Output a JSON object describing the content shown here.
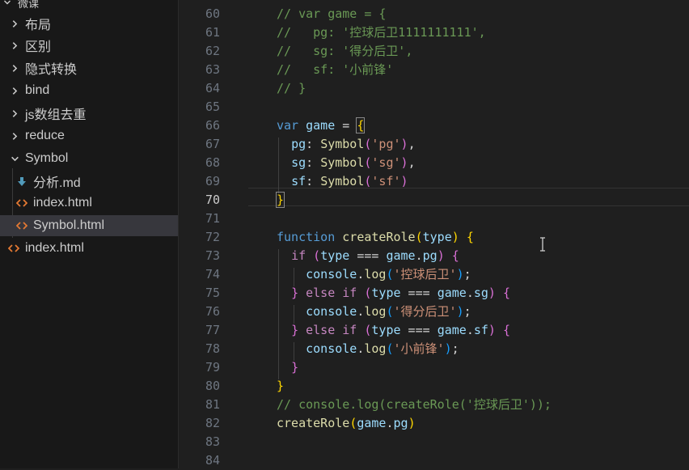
{
  "sidebar": {
    "header": "微课",
    "items": [
      {
        "label": "布局",
        "kind": "folder",
        "expanded": false
      },
      {
        "label": "区别",
        "kind": "folder",
        "expanded": false
      },
      {
        "label": "隐式转换",
        "kind": "folder",
        "expanded": false
      },
      {
        "label": "bind",
        "kind": "folder",
        "expanded": false
      },
      {
        "label": "js数组去重",
        "kind": "folder",
        "expanded": false
      },
      {
        "label": "reduce",
        "kind": "folder",
        "expanded": false
      },
      {
        "label": "Symbol",
        "kind": "folder",
        "expanded": true
      },
      {
        "label": "分析.md",
        "kind": "markdown-file"
      },
      {
        "label": "index.html",
        "kind": "html-file"
      },
      {
        "label": "Symbol.html",
        "kind": "html-file",
        "selected": true
      },
      {
        "label": "index.html",
        "kind": "html-file"
      }
    ]
  },
  "editor": {
    "active_line": 70,
    "lines": [
      {
        "n": 60,
        "tokens": [
          [
            "cmt",
            "// var game = {"
          ]
        ]
      },
      {
        "n": 61,
        "tokens": [
          [
            "cmt",
            "//   pg: '控球后卫1111111111',"
          ]
        ]
      },
      {
        "n": 62,
        "tokens": [
          [
            "cmt",
            "//   sg: '得分后卫',"
          ]
        ]
      },
      {
        "n": 63,
        "tokens": [
          [
            "cmt",
            "//   sf: '小前锋'"
          ]
        ]
      },
      {
        "n": 64,
        "tokens": [
          [
            "cmt",
            "// }"
          ]
        ]
      },
      {
        "n": 65,
        "tokens": []
      },
      {
        "n": 66,
        "tokens": [
          [
            "kw",
            "var"
          ],
          [
            "",
            " "
          ],
          [
            "var",
            "game"
          ],
          [
            "",
            " = "
          ],
          [
            "p1 bm",
            "{"
          ]
        ]
      },
      {
        "n": 67,
        "tokens": [
          [
            "",
            "  "
          ],
          [
            "var",
            "pg"
          ],
          [
            "",
            ": "
          ],
          [
            "fn",
            "Symbol"
          ],
          [
            "p2",
            "("
          ],
          [
            "str",
            "'pg'"
          ],
          [
            "p2",
            ")"
          ],
          [
            "",
            ","
          ]
        ]
      },
      {
        "n": 68,
        "tokens": [
          [
            "",
            "  "
          ],
          [
            "var",
            "sg"
          ],
          [
            "",
            ": "
          ],
          [
            "fn",
            "Symbol"
          ],
          [
            "p2",
            "("
          ],
          [
            "str",
            "'sg'"
          ],
          [
            "p2",
            ")"
          ],
          [
            "",
            ","
          ]
        ]
      },
      {
        "n": 69,
        "tokens": [
          [
            "",
            "  "
          ],
          [
            "var",
            "sf"
          ],
          [
            "",
            ": "
          ],
          [
            "fn",
            "Symbol"
          ],
          [
            "p2",
            "("
          ],
          [
            "str",
            "'sf'"
          ],
          [
            "p2",
            ")"
          ]
        ]
      },
      {
        "n": 70,
        "tokens": [
          [
            "p1 bm",
            "}"
          ]
        ]
      },
      {
        "n": 71,
        "tokens": []
      },
      {
        "n": 72,
        "tokens": [
          [
            "kw",
            "function"
          ],
          [
            "",
            " "
          ],
          [
            "fn",
            "createRole"
          ],
          [
            "p1",
            "("
          ],
          [
            "var",
            "type"
          ],
          [
            "p1",
            ")"
          ],
          [
            "",
            " "
          ],
          [
            "p1",
            "{"
          ]
        ]
      },
      {
        "n": 73,
        "tokens": [
          [
            "",
            "  "
          ],
          [
            "kw2",
            "if"
          ],
          [
            "",
            " "
          ],
          [
            "p2",
            "("
          ],
          [
            "var",
            "type"
          ],
          [
            "",
            " === "
          ],
          [
            "var",
            "game"
          ],
          [
            "",
            "."
          ],
          [
            "var",
            "pg"
          ],
          [
            "p2",
            ")"
          ],
          [
            "",
            " "
          ],
          [
            "p2",
            "{"
          ]
        ]
      },
      {
        "n": 74,
        "tokens": [
          [
            "",
            "    "
          ],
          [
            "var",
            "console"
          ],
          [
            "",
            "."
          ],
          [
            "fn",
            "log"
          ],
          [
            "p3",
            "("
          ],
          [
            "str",
            "'控球后卫'"
          ],
          [
            "p3",
            ")"
          ],
          [
            "",
            ";"
          ]
        ]
      },
      {
        "n": 75,
        "tokens": [
          [
            "",
            "  "
          ],
          [
            "p2",
            "}"
          ],
          [
            "",
            " "
          ],
          [
            "kw2",
            "else if"
          ],
          [
            "",
            " "
          ],
          [
            "p2",
            "("
          ],
          [
            "var",
            "type"
          ],
          [
            "",
            " === "
          ],
          [
            "var",
            "game"
          ],
          [
            "",
            "."
          ],
          [
            "var",
            "sg"
          ],
          [
            "p2",
            ")"
          ],
          [
            "",
            " "
          ],
          [
            "p2",
            "{"
          ]
        ]
      },
      {
        "n": 76,
        "tokens": [
          [
            "",
            "    "
          ],
          [
            "var",
            "console"
          ],
          [
            "",
            "."
          ],
          [
            "fn",
            "log"
          ],
          [
            "p3",
            "("
          ],
          [
            "str",
            "'得分后卫'"
          ],
          [
            "p3",
            ")"
          ],
          [
            "",
            ";"
          ]
        ]
      },
      {
        "n": 77,
        "tokens": [
          [
            "",
            "  "
          ],
          [
            "p2",
            "}"
          ],
          [
            "",
            " "
          ],
          [
            "kw2",
            "else if"
          ],
          [
            "",
            " "
          ],
          [
            "p2",
            "("
          ],
          [
            "var",
            "type"
          ],
          [
            "",
            " === "
          ],
          [
            "var",
            "game"
          ],
          [
            "",
            "."
          ],
          [
            "var",
            "sf"
          ],
          [
            "p2",
            ")"
          ],
          [
            "",
            " "
          ],
          [
            "p2",
            "{"
          ]
        ]
      },
      {
        "n": 78,
        "tokens": [
          [
            "",
            "    "
          ],
          [
            "var",
            "console"
          ],
          [
            "",
            "."
          ],
          [
            "fn",
            "log"
          ],
          [
            "p3",
            "("
          ],
          [
            "str",
            "'小前锋'"
          ],
          [
            "p3",
            ")"
          ],
          [
            "",
            ";"
          ]
        ]
      },
      {
        "n": 79,
        "tokens": [
          [
            "",
            "  "
          ],
          [
            "p2",
            "}"
          ]
        ]
      },
      {
        "n": 80,
        "tokens": [
          [
            "p1",
            "}"
          ]
        ]
      },
      {
        "n": 81,
        "tokens": [
          [
            "cmt",
            "// console.log(createRole('控球后卫'));"
          ]
        ]
      },
      {
        "n": 82,
        "tokens": [
          [
            "fn",
            "createRole"
          ],
          [
            "p1",
            "("
          ],
          [
            "var",
            "game"
          ],
          [
            "",
            "."
          ],
          [
            "var",
            "pg"
          ],
          [
            "p1",
            ")"
          ]
        ]
      },
      {
        "n": 83,
        "tokens": []
      },
      {
        "n": 84,
        "tokens": []
      }
    ]
  },
  "icons": {
    "chevron_collapsed": "chevron-right-icon",
    "chevron_expanded": "chevron-down-icon",
    "html_file": "html-file-icon",
    "markdown_file": "markdown-file-icon",
    "text_cursor": "text-cursor-icon"
  },
  "colors": {
    "editor_bg": "#1f1f1f",
    "sidebar_bg": "#181818",
    "selection_bg": "#37373d",
    "comment": "#6a9955",
    "keyword": "#569cd6",
    "string": "#ce9178",
    "function": "#dcdcaa",
    "variable": "#9cdcfe"
  }
}
